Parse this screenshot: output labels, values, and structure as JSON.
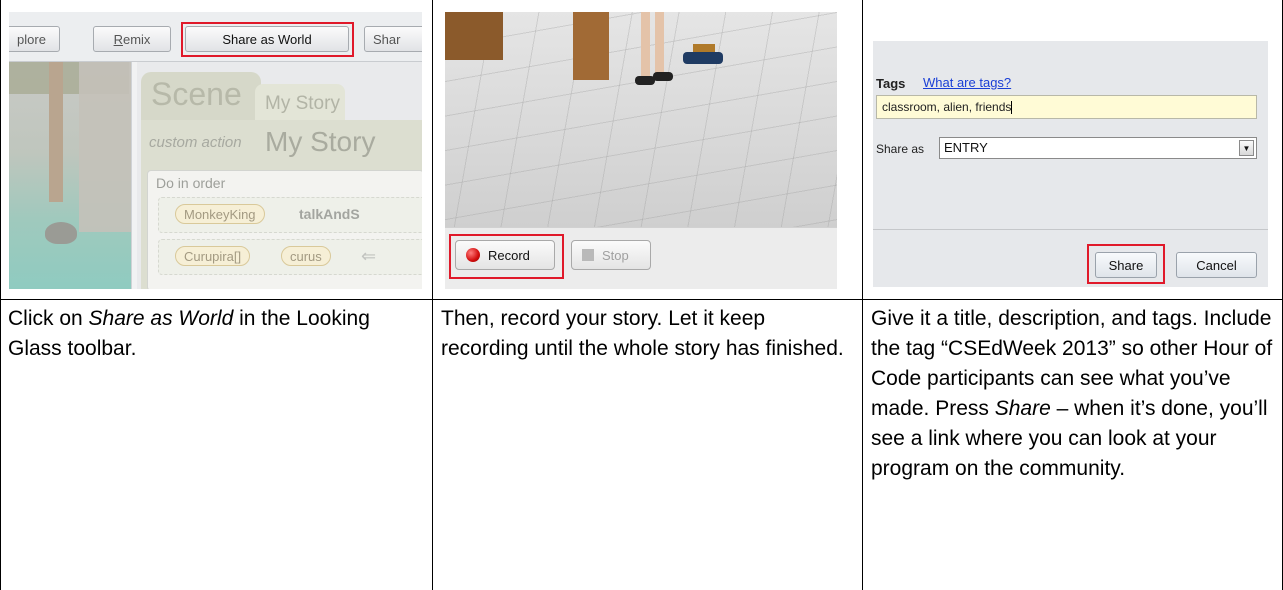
{
  "panel1": {
    "toolbar": {
      "explore_partial": "plore",
      "remix_first": "R",
      "remix_rest": "emix",
      "share_world": "Share as World",
      "share_partial": "Shar"
    },
    "editor": {
      "scene_tab": "Scene",
      "story_tab": "My Story",
      "custom_action": "custom action",
      "story_title": "My Story",
      "do_in_order": "Do in order",
      "stmt1_object": "MonkeyKing",
      "stmt1_method": "talkAndS",
      "stmt2_object": "Curupira[]",
      "stmt2_arg": "curus"
    }
  },
  "panel2": {
    "record_label": "Record",
    "stop_label": "Stop"
  },
  "panel3": {
    "tags_label": "Tags",
    "tags_link": "What are tags?",
    "tags_value": "classroom, alien, friends",
    "share_as_label": "Share as",
    "share_as_value": "ENTRY",
    "share_button": "Share",
    "cancel_button": "Cancel"
  },
  "captions": {
    "col1_pre": "Click on ",
    "col1_em": "Share as World",
    "col1_post": " in the Looking Glass toolbar.",
    "col2": "Then, record your story. Let it keep recording until the whole story has finished.",
    "col3_pre": "Give it a title, description, and tags. Include the tag “CSEdWeek 2013” so other Hour of Code participants can see what you’ve made. Press ",
    "col3_em": "Share",
    "col3_post": " – when it’s done, you’ll see a link where you can look at your program on the community."
  },
  "colors": {
    "highlight_red": "#e0192a",
    "link_blue": "#1a3fd6",
    "tags_field_bg": "#fffbd6"
  }
}
